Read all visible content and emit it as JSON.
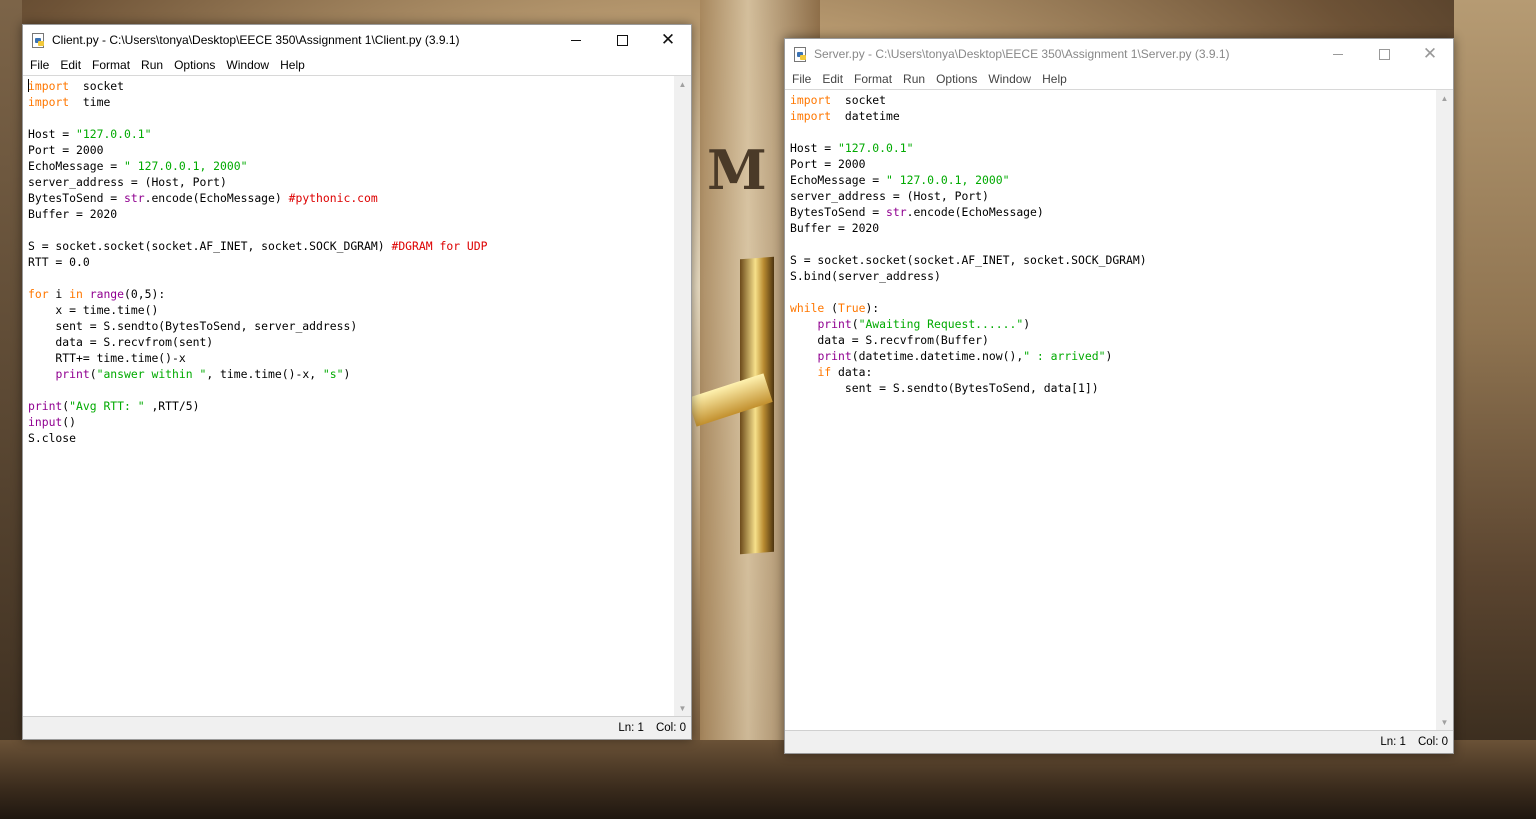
{
  "client_window": {
    "title": "Client.py - C:\\Users\\tonya\\Desktop\\EECE 350\\Assignment 1\\Client.py (3.9.1)",
    "menu": [
      "File",
      "Edit",
      "Format",
      "Run",
      "Options",
      "Window",
      "Help"
    ],
    "status": {
      "line": "Ln: 1",
      "col": "Col: 0"
    },
    "code_lines": [
      [
        [
          "kw",
          "import"
        ],
        [
          "",
          "  socket"
        ]
      ],
      [
        [
          "kw",
          "import"
        ],
        [
          "",
          "  time"
        ]
      ],
      [],
      [
        [
          "",
          "Host = "
        ],
        [
          "str",
          "\"127.0.0.1\""
        ]
      ],
      [
        [
          "",
          "Port = 2000"
        ]
      ],
      [
        [
          "",
          "EchoMessage = "
        ],
        [
          "str",
          "\" 127.0.0.1, 2000\""
        ]
      ],
      [
        [
          "",
          "server_address = (Host, Port)"
        ]
      ],
      [
        [
          "",
          "BytesToSend = "
        ],
        [
          "bi",
          "str"
        ],
        [
          "",
          ".encode(EchoMessage) "
        ],
        [
          "cmt",
          "#pythonic.com"
        ]
      ],
      [
        [
          "",
          "Buffer = 2020"
        ]
      ],
      [],
      [
        [
          "",
          "S = socket.socket(socket.AF_INET, socket.SOCK_DGRAM) "
        ],
        [
          "cmt",
          "#DGRAM for UDP"
        ]
      ],
      [
        [
          "",
          "RTT = 0.0"
        ]
      ],
      [],
      [
        [
          "kw",
          "for"
        ],
        [
          "",
          " i "
        ],
        [
          "kw",
          "in"
        ],
        [
          "",
          " "
        ],
        [
          "bi",
          "range"
        ],
        [
          "",
          "(0,5):"
        ]
      ],
      [
        [
          "",
          "    x = time.time()"
        ]
      ],
      [
        [
          "",
          "    sent = S.sendto(BytesToSend, server_address)"
        ]
      ],
      [
        [
          "",
          "    data = S.recvfrom(sent)"
        ]
      ],
      [
        [
          "",
          "    RTT+= time.time()-x"
        ]
      ],
      [
        [
          "",
          "    "
        ],
        [
          "bi",
          "print"
        ],
        [
          "",
          "("
        ],
        [
          "str",
          "\"answer within \""
        ],
        [
          "",
          ", time.time()-x, "
        ],
        [
          "str",
          "\"s\""
        ],
        [
          "",
          ")"
        ]
      ],
      [],
      [
        [
          "bi",
          "print"
        ],
        [
          "",
          "("
        ],
        [
          "str",
          "\"Avg RTT: \""
        ],
        [
          "",
          " ,RTT/5)"
        ]
      ],
      [
        [
          "bi",
          "input"
        ],
        [
          "",
          "()"
        ]
      ],
      [
        [
          "",
          "S.close"
        ]
      ]
    ]
  },
  "server_window": {
    "title": "Server.py - C:\\Users\\tonya\\Desktop\\EECE 350\\Assignment 1\\Server.py (3.9.1)",
    "menu": [
      "File",
      "Edit",
      "Format",
      "Run",
      "Options",
      "Window",
      "Help"
    ],
    "status": {
      "line": "Ln: 1",
      "col": "Col: 0"
    },
    "code_lines": [
      [
        [
          "kw",
          "import"
        ],
        [
          "",
          "  socket"
        ]
      ],
      [
        [
          "kw",
          "import"
        ],
        [
          "",
          "  datetime"
        ]
      ],
      [],
      [
        [
          "",
          "Host = "
        ],
        [
          "str",
          "\"127.0.0.1\""
        ]
      ],
      [
        [
          "",
          "Port = 2000"
        ]
      ],
      [
        [
          "",
          "EchoMessage = "
        ],
        [
          "str",
          "\" 127.0.0.1, 2000\""
        ]
      ],
      [
        [
          "",
          "server_address = (Host, Port)"
        ]
      ],
      [
        [
          "",
          "BytesToSend = "
        ],
        [
          "bi",
          "str"
        ],
        [
          "",
          ".encode(EchoMessage)"
        ]
      ],
      [
        [
          "",
          "Buffer = 2020"
        ]
      ],
      [],
      [
        [
          "",
          "S = socket.socket(socket.AF_INET, socket.SOCK_DGRAM)"
        ]
      ],
      [
        [
          "",
          "S.bind(server_address)"
        ]
      ],
      [],
      [
        [
          "kw",
          "while"
        ],
        [
          "",
          " ("
        ],
        [
          "kw",
          "True"
        ],
        [
          "",
          "):"
        ]
      ],
      [
        [
          "",
          "    "
        ],
        [
          "bi",
          "print"
        ],
        [
          "",
          "("
        ],
        [
          "str",
          "\"Awaiting Request......\""
        ],
        [
          "",
          ")"
        ]
      ],
      [
        [
          "",
          "    data = S.recvfrom(Buffer)"
        ]
      ],
      [
        [
          "",
          "    "
        ],
        [
          "bi",
          "print"
        ],
        [
          "",
          "(datetime.datetime.now(),"
        ],
        [
          "str",
          "\" : arrived\""
        ],
        [
          "",
          ")"
        ]
      ],
      [
        [
          "",
          "    "
        ],
        [
          "kw",
          "if"
        ],
        [
          "",
          " data:"
        ]
      ],
      [
        [
          "",
          "        sent = S.sendto(BytesToSend, data[1])"
        ]
      ]
    ]
  },
  "background": {
    "letters": "M"
  }
}
